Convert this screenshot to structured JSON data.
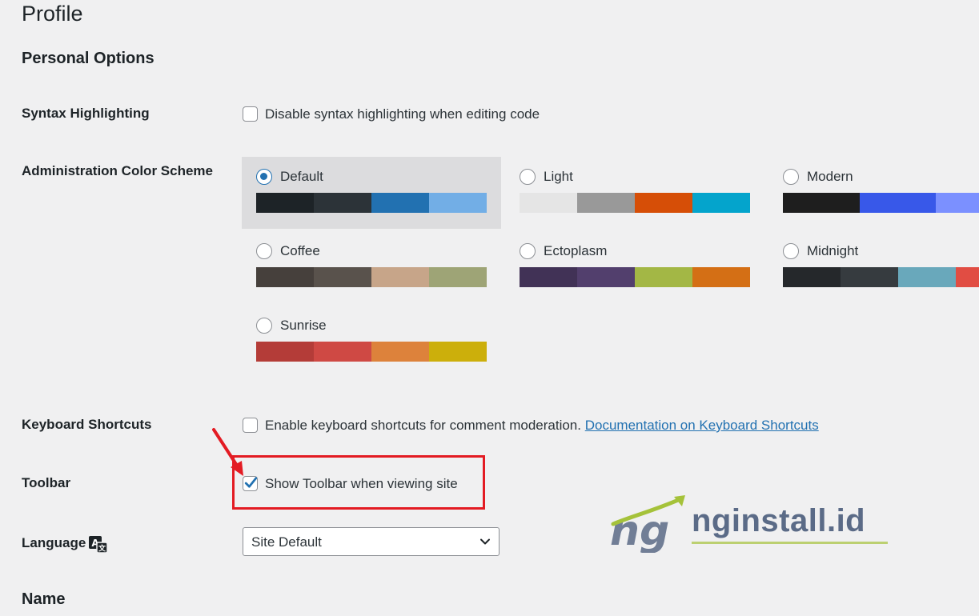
{
  "page": {
    "title": "Profile",
    "section_personal": "Personal Options",
    "section_name": "Name"
  },
  "syntax": {
    "label": "Syntax Highlighting",
    "option": "Disable syntax highlighting when editing code",
    "checked": false
  },
  "color_scheme": {
    "label": "Administration Color Scheme",
    "selected": "Default",
    "schemes": [
      {
        "name": "Default",
        "colors": [
          "#1d2327",
          "#2c3338",
          "#2271b1",
          "#72aee6"
        ]
      },
      {
        "name": "Light",
        "colors": [
          "#e5e5e5",
          "#999999",
          "#d64e07",
          "#04a4cc"
        ]
      },
      {
        "name": "Modern",
        "colors": [
          "#1e1e1e",
          "#3858e9",
          "#7b90ff"
        ]
      },
      {
        "name": "Coffee",
        "colors": [
          "#46403c",
          "#59524c",
          "#c7a589",
          "#9ea476"
        ]
      },
      {
        "name": "Ectoplasm",
        "colors": [
          "#413256",
          "#523f6d",
          "#a3b745",
          "#d46f15"
        ]
      },
      {
        "name": "Midnight",
        "colors": [
          "#25282b",
          "#363b3f",
          "#69a8bb",
          "#e14d43"
        ]
      },
      {
        "name": "Sunrise",
        "colors": [
          "#b43c38",
          "#cf4944",
          "#dd823b",
          "#ccaf0b"
        ]
      }
    ]
  },
  "keyboard": {
    "label": "Keyboard Shortcuts",
    "option": "Enable keyboard shortcuts for comment moderation.",
    "link": "Documentation on Keyboard Shortcuts",
    "checked": false
  },
  "toolbar": {
    "label": "Toolbar",
    "option": "Show Toolbar when viewing site",
    "checked": true
  },
  "language": {
    "label": "Language",
    "icon": "translate-icon",
    "selected": "Site Default"
  },
  "watermark": {
    "text": "nginstall.id",
    "logo_text": "ng"
  },
  "colors": {
    "accent": "#2271b1",
    "highlight": "#e31b23"
  }
}
